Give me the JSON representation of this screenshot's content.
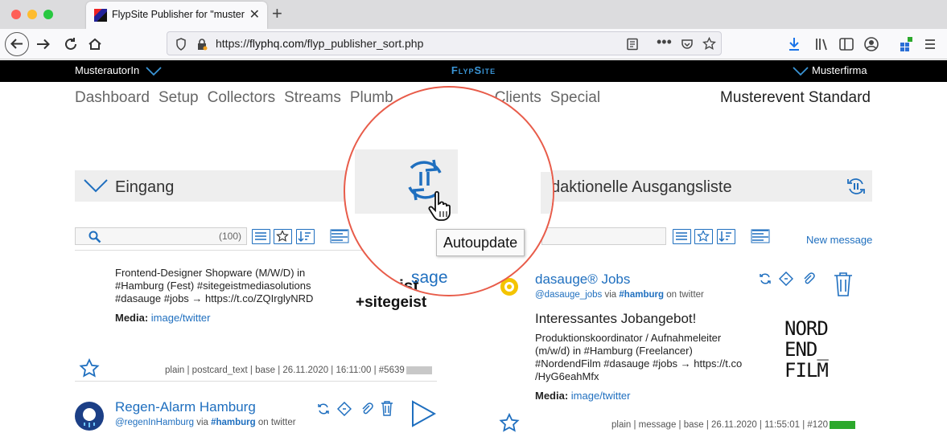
{
  "browser": {
    "tab_title": "FlypSite Publisher for \"musterfi",
    "url_prefix": "https://",
    "url_domain": "flyphq.com",
    "url_path": "/flyp_publisher_sort.php",
    "new_tab": "+",
    "tab_close": "✕"
  },
  "site": {
    "user": "MusterautorIn",
    "brand": "FlypSite",
    "company": "Musterfirma",
    "nav": [
      "Dashboard",
      "Setup",
      "Collectors",
      "Streams",
      "Plumb",
      "Clients",
      "Special"
    ],
    "event": "Musterevent Standard"
  },
  "left_panel": {
    "title": "Eingang",
    "count": "(100)",
    "item1": {
      "text": [
        "Frontend-Designer Shopware (M/W/D) in",
        "#Hamburg (Fest) #sitegeistmediasolutions",
        "#dasauge #jobs → https://t.co/ZQIrglyNRD"
      ],
      "media_label": "Media:",
      "media_link": "image/twitter",
      "logo_partial": "sage",
      "logo_text": "+sitegeist",
      "meta": "plain | postcard_text | base | 26.11.2020 | 16:11:00 | #5639"
    },
    "item2": {
      "title": "Regen-Alarm Hamburg",
      "handle": "@regenInHamburg",
      "via": "via",
      "tag": "#hamburg",
      "on": "on twitter"
    }
  },
  "right_panel": {
    "title": "daktionelle Ausgangsliste",
    "new_message": "New message",
    "item1": {
      "title": "dasauge® Jobs",
      "handle": "@dasauge_jobs",
      "via": "via",
      "tag": "#hamburg",
      "on": "on twitter",
      "headline": "Interessantes Jobangebot!",
      "text": [
        "Produktionskoordinator / Aufnahmeleiter",
        "(m/w/d) in #Hamburg (Freelancer)",
        "#NordendFilm #dasauge #jobs → https://t.co",
        "/HyG6eahMfx"
      ],
      "media_label": "Media:",
      "media_link": "image/twitter",
      "logo_lines": [
        "NORD",
        "END_",
        "FILM"
      ],
      "meta": "plain | message | base | 26.11.2020 | 11:55:01 | #120"
    }
  },
  "tooltip": "Autoupdate",
  "colors": {
    "accent": "#1f6fbf",
    "brand": "#3a95d6",
    "circle": "#e85c4a",
    "bar_gray": "#c8c8c8",
    "bar_green": "#2ca82c"
  }
}
